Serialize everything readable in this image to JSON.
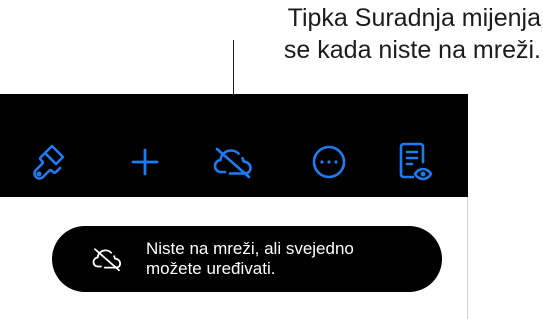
{
  "callout": {
    "line1": "Tipka Suradnja mijenja",
    "line2": "se kada niste na mreži."
  },
  "toolbar": {
    "accent_color": "#1e7cf2",
    "buttons": [
      {
        "icon": "paintbrush-icon",
        "name": "format-button"
      },
      {
        "icon": "plus-icon",
        "name": "insert-button"
      },
      {
        "icon": "cloud-offline-icon",
        "name": "collaborate-button"
      },
      {
        "icon": "more-icon",
        "name": "more-button"
      },
      {
        "icon": "reading-view-icon",
        "name": "reading-view-button"
      }
    ]
  },
  "toast": {
    "icon": "cloud-offline-icon",
    "line1": "Niste na mreži, ali svejedno",
    "line2": "možete uređivati."
  }
}
